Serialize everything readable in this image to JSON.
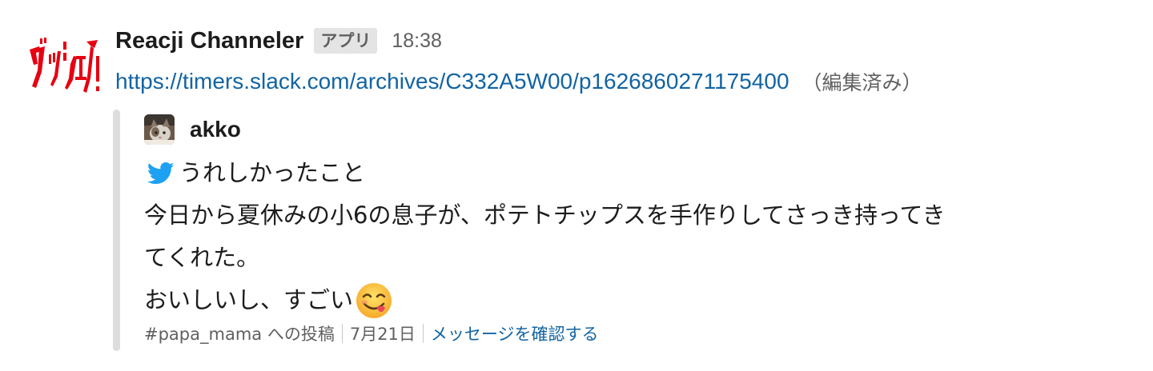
{
  "message": {
    "sender": "Reacji Channeler",
    "app_badge": "アプリ",
    "time": "18:38",
    "link": "https://timers.slack.com/archives/C332A5W00/p1626860271175400",
    "edited": "（編集済み）",
    "app_icon_name": "reacji-guwashare-logo",
    "app_icon_text": "グッシェア!"
  },
  "attachment": {
    "author": "akko",
    "line1": "うれしかったこと",
    "line2": "今日から夏休みの小6の息子が、ポテトチップスを手作りしてさっき持ってき",
    "line3": "てくれた。",
    "line4": "おいしいし、すごい",
    "icons": {
      "source": "twitter-bird-icon",
      "emoji": "yum-face-emoji"
    },
    "footer": {
      "channel": "#papa_mama への投稿",
      "date": "7月21日",
      "view_link": "メッセージを確認する"
    }
  },
  "colors": {
    "link": "#1264a3",
    "muted": "#616061",
    "bar": "#dddddd",
    "twitter": "#1da1f2",
    "logo_red": "#e60012"
  }
}
